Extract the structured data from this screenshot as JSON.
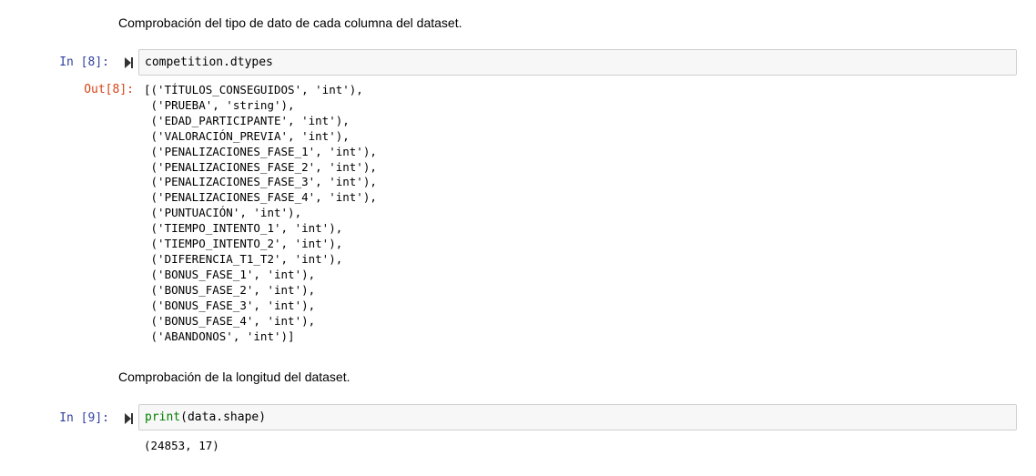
{
  "cells": [
    {
      "type": "markdown",
      "text": "Comprobación del tipo de dato de cada columna del dataset."
    },
    {
      "type": "code",
      "prompt": "In [8]:",
      "code": "competition.dtypes",
      "out_prompt": "Out[8]:",
      "output": [
        "[('TÍTULOS_CONSEGUIDOS', 'int'),",
        " ('PRUEBA', 'string'),",
        " ('EDAD_PARTICIPANTE', 'int'),",
        " ('VALORACIÓN_PREVIA', 'int'),",
        " ('PENALIZACIONES_FASE_1', 'int'),",
        " ('PENALIZACIONES_FASE_2', 'int'),",
        " ('PENALIZACIONES_FASE_3', 'int'),",
        " ('PENALIZACIONES_FASE_4', 'int'),",
        " ('PUNTUACIÓN', 'int'),",
        " ('TIEMPO_INTENTO_1', 'int'),",
        " ('TIEMPO_INTENTO_2', 'int'),",
        " ('DIFERENCIA_T1_T2', 'int'),",
        " ('BONUS_FASE_1', 'int'),",
        " ('BONUS_FASE_2', 'int'),",
        " ('BONUS_FASE_3', 'int'),",
        " ('BONUS_FASE_4', 'int'),",
        " ('ABANDONOS', 'int')]"
      ]
    },
    {
      "type": "markdown",
      "text": "Comprobación de la longitud del dataset."
    },
    {
      "type": "code",
      "prompt": "In [9]:",
      "code_builtin": "print",
      "code_rest": "(data.shape)",
      "output_text": "(24853, 17)"
    }
  ],
  "colors": {
    "in_prompt": "#303f9f",
    "out_prompt": "#d84315",
    "builtin": "#008000",
    "cell_bg": "#f7f7f7"
  },
  "icons": {
    "run": "run-cell-icon"
  }
}
